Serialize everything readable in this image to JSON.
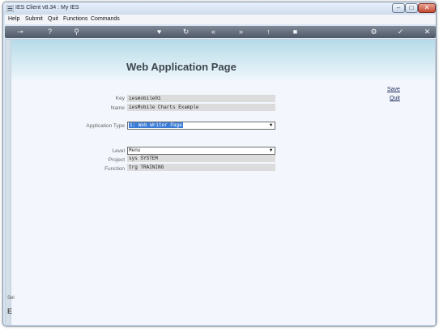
{
  "window": {
    "title": "IES Client v8.34 : My IES"
  },
  "menu": [
    {
      "label": "Help"
    },
    {
      "label": "Submit"
    },
    {
      "label": "Quit"
    },
    {
      "label": "Functions"
    },
    {
      "label": "Commands"
    }
  ],
  "toolbar": {
    "icons": [
      "key-icon",
      "help-icon",
      "search-icon",
      "heart-icon",
      "refresh-icon",
      "rewind-icon",
      "fast-forward-icon",
      "upload-icon",
      "stop-icon",
      "settings-icon",
      "check-icon",
      "close-icon"
    ]
  },
  "page": {
    "title": "Web Application Page",
    "save_label": "Save",
    "quit_label": "Quit"
  },
  "fields": {
    "key": {
      "label": "Key",
      "value": "iesmobile01"
    },
    "name": {
      "label": "Name",
      "value": "iesMobile Charts Example"
    },
    "application_type": {
      "label": "Application Type",
      "value": "1: Web Writer Page"
    },
    "level": {
      "label": "Level",
      "value": "Menu"
    },
    "project": {
      "label": "Project",
      "value": "sys SYSTEM"
    },
    "function": {
      "label": "Function",
      "value": "trg TRAINING"
    }
  },
  "sidebar": {
    "hint_top": "Sel",
    "hint_bottom": "E"
  }
}
